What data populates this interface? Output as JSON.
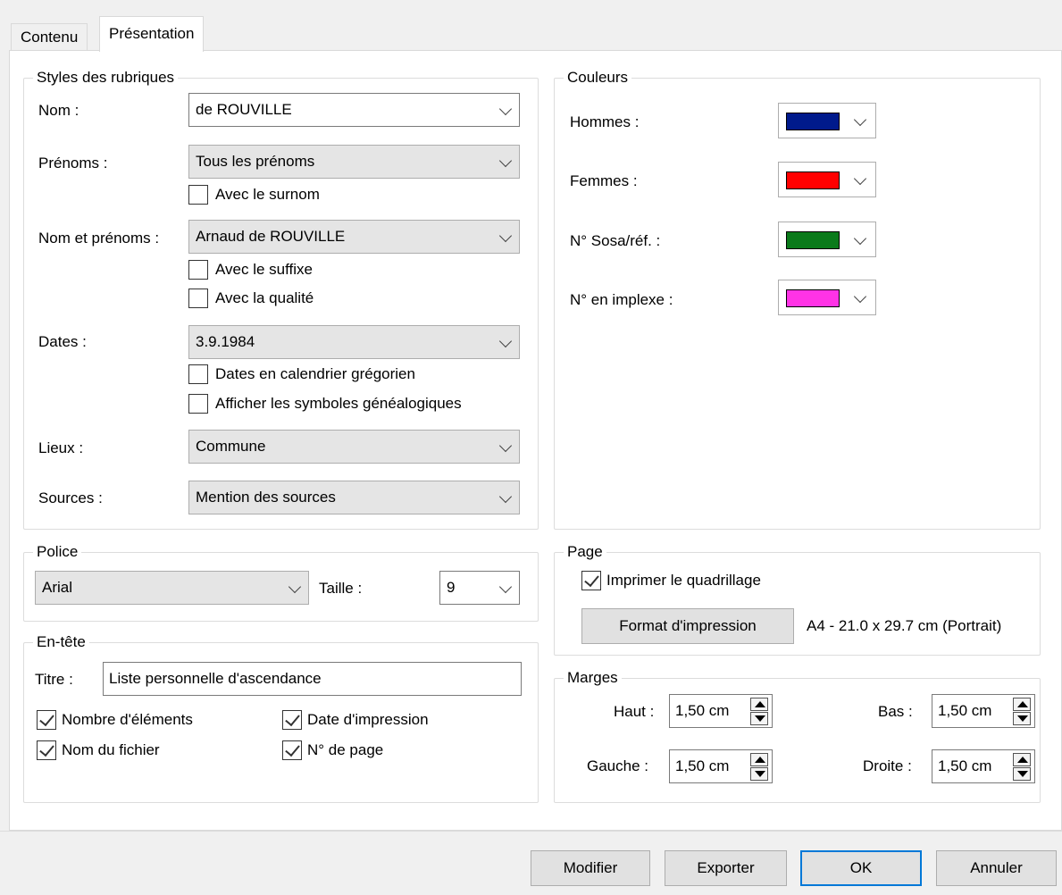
{
  "tabs": [
    {
      "label": "Contenu"
    },
    {
      "label": "Présentation"
    }
  ],
  "styles": {
    "legend": "Styles des rubriques",
    "nom": {
      "label": "Nom :",
      "value": "de ROUVILLE"
    },
    "prenoms": {
      "label": "Prénoms :",
      "value": "Tous les prénoms",
      "check_surnom": "Avec le surnom"
    },
    "nom_prenoms": {
      "label": "Nom et prénoms :",
      "value": "Arnaud de ROUVILLE",
      "check_suffixe": "Avec le suffixe",
      "check_qualite": "Avec la qualité"
    },
    "dates": {
      "label": "Dates :",
      "value": "3.9.1984",
      "check_gregorien": "Dates en calendrier grégorien",
      "check_symboles": "Afficher les symboles généalogiques"
    },
    "lieux": {
      "label": "Lieux :",
      "value": "Commune"
    },
    "sources": {
      "label": "Sources :",
      "value": "Mention des sources"
    }
  },
  "couleurs": {
    "legend": "Couleurs",
    "items": [
      {
        "label": "Hommes :",
        "color": "#001a8c"
      },
      {
        "label": "Femmes :",
        "color": "#ff0000"
      },
      {
        "label": "N° Sosa/réf. :",
        "color": "#0a7a1a"
      },
      {
        "label": "N° en implexe :",
        "color": "#ff33e6"
      }
    ]
  },
  "police": {
    "legend": "Police",
    "font": "Arial",
    "taille_label": "Taille :",
    "taille": "9"
  },
  "page": {
    "legend": "Page",
    "grid_label": "Imprimer le quadrillage",
    "format_button": "Format d'impression",
    "format_value": "A4 - 21.0 x 29.7 cm (Portrait)"
  },
  "entete": {
    "legend": "En-tête",
    "titre_label": "Titre :",
    "titre_value": "Liste personnelle d'ascendance",
    "nb_elements": "Nombre d'éléments",
    "date_impression": "Date d'impression",
    "nom_fichier": "Nom du fichier",
    "num_page": "N° de page"
  },
  "marges": {
    "legend": "Marges",
    "haut_label": "Haut :",
    "haut": "1,50 cm",
    "bas_label": "Bas :",
    "bas": "1,50 cm",
    "gauche_label": "Gauche :",
    "gauche": "1,50 cm",
    "droite_label": "Droite :",
    "droite": "1,50 cm"
  },
  "buttons": {
    "modifier": "Modifier",
    "exporter": "Exporter",
    "ok": "OK",
    "annuler": "Annuler"
  }
}
